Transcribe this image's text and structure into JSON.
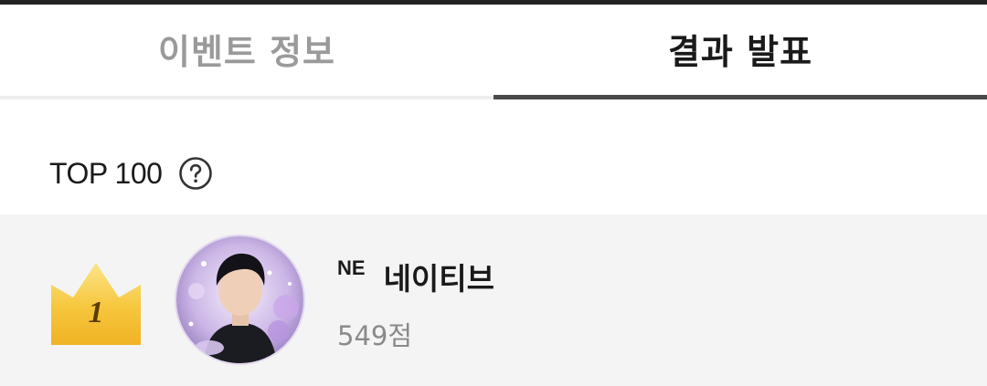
{
  "tabs": [
    {
      "label": "이벤트 정보",
      "active": false
    },
    {
      "label": "결과 발표",
      "active": true
    }
  ],
  "ranking": {
    "title": "TOP 100",
    "help_icon": "question-circle-icon"
  },
  "entries": [
    {
      "rank": "1",
      "badge": "NE",
      "name": "네이티브",
      "score": "549점",
      "crown_icon": "crown-icon"
    }
  ],
  "colors": {
    "active_tab_text": "#1a1a1a",
    "inactive_tab_text": "#9a9a9a",
    "active_tab_indicator": "#4a4a4a",
    "row_background": "#f4f4f4",
    "crown_gold": "#f5c53a",
    "score_text": "#8a8a8a"
  }
}
